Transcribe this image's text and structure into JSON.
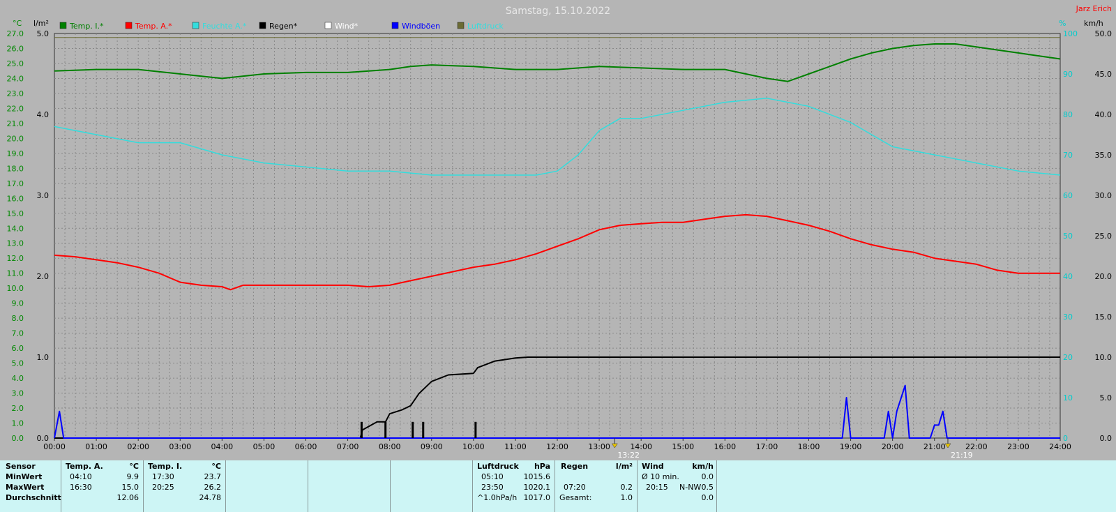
{
  "title": "Samstag, 15.10.2022",
  "author": "Jarz Erich",
  "colors": {
    "background": "#b5b5b5",
    "plot_bg": "#b5b5b5",
    "temp_inside": "#008000",
    "temp_outside": "#ff0000",
    "humidity": "#33dddd",
    "rain": "#000000",
    "wind": "#ffffff",
    "gusts": "#0000ff",
    "pressure": "#6b6b33",
    "temp_axis": "#008800",
    "right_axis": "#00cccc"
  },
  "chart_data": {
    "type": "line",
    "title": "Samstag, 15.10.2022",
    "x_ticks": [
      "00:00",
      "01:00",
      "02:00",
      "03:00",
      "04:00",
      "05:00",
      "06:00",
      "07:00",
      "08:00",
      "09:00",
      "10:00",
      "11:00",
      "12:00",
      "13:00",
      "14:00",
      "15:00",
      "16:00",
      "17:00",
      "18:00",
      "19:00",
      "20:00",
      "21:00",
      "22:00",
      "23:00",
      "24:00"
    ],
    "xlim": [
      0,
      24
    ],
    "axes": {
      "temp": {
        "unit": "°C",
        "ylim": [
          0,
          27
        ],
        "ticks": [
          "0.0",
          "1.0",
          "2.0",
          "3.0",
          "4.0",
          "5.0",
          "6.0",
          "7.0",
          "8.0",
          "9.0",
          "10.0",
          "11.0",
          "12.0",
          "13.0",
          "14.0",
          "15.0",
          "16.0",
          "17.0",
          "18.0",
          "19.0",
          "20.0",
          "21.0",
          "22.0",
          "23.0",
          "24.0",
          "25.0",
          "26.0",
          "27.0"
        ]
      },
      "rain": {
        "unit": "l/m²",
        "ylim": [
          0,
          5
        ],
        "ticks": [
          "0.0",
          "1.0",
          "2.0",
          "3.0",
          "4.0",
          "5.0"
        ]
      },
      "humidity": {
        "unit": "%",
        "ylim": [
          0,
          100
        ],
        "ticks": [
          "0",
          "10",
          "20",
          "30",
          "40",
          "50",
          "60",
          "70",
          "80",
          "90",
          "100"
        ]
      },
      "wind": {
        "unit": "km/h",
        "ylim": [
          0,
          50
        ],
        "ticks": [
          "0.0",
          "5.0",
          "10.0",
          "15.0",
          "20.0",
          "25.0",
          "30.0",
          "35.0",
          "40.0",
          "45.0",
          "50.0"
        ]
      }
    },
    "legend": [
      "Temp. I.*",
      "Temp. A.*",
      "Feuchte A.*",
      "Regen*",
      "Wind*",
      "Windböen",
      "Luftdruck"
    ],
    "series": [
      {
        "name": "Temp. I.*",
        "axis": "temp",
        "x": [
          0,
          1,
          2,
          3,
          4,
          5,
          6,
          7,
          8,
          8.5,
          9,
          10,
          11,
          12,
          13,
          14,
          15,
          16,
          16.5,
          17,
          17.5,
          18,
          18.5,
          19,
          19.5,
          20,
          20.5,
          21,
          21.5,
          22,
          22.5,
          23,
          23.5,
          24
        ],
        "y": [
          24.5,
          24.6,
          24.6,
          24.3,
          24.0,
          24.3,
          24.4,
          24.4,
          24.6,
          24.8,
          24.9,
          24.8,
          24.6,
          24.6,
          24.8,
          24.7,
          24.6,
          24.6,
          24.3,
          24.0,
          23.8,
          24.3,
          24.8,
          25.3,
          25.7,
          26.0,
          26.2,
          26.3,
          26.3,
          26.1,
          25.9,
          25.7,
          25.5,
          25.3
        ]
      },
      {
        "name": "Temp. A.*",
        "axis": "temp",
        "x": [
          0,
          0.5,
          1,
          1.5,
          2,
          2.5,
          3,
          3.5,
          4,
          4.2,
          4.5,
          5,
          6,
          7,
          7.5,
          8,
          8.5,
          9,
          9.5,
          10,
          10.5,
          11,
          11.5,
          12,
          12.5,
          13,
          13.5,
          14,
          14.5,
          15,
          15.5,
          16,
          16.5,
          17,
          17.5,
          18,
          18.5,
          19,
          19.5,
          20,
          20.5,
          21,
          21.5,
          22,
          22.5,
          23,
          23.5,
          24
        ],
        "y": [
          12.2,
          12.1,
          11.9,
          11.7,
          11.4,
          11.0,
          10.4,
          10.2,
          10.1,
          9.9,
          10.2,
          10.2,
          10.2,
          10.2,
          10.1,
          10.2,
          10.5,
          10.8,
          11.1,
          11.4,
          11.6,
          11.9,
          12.3,
          12.8,
          13.3,
          13.9,
          14.2,
          14.3,
          14.4,
          14.4,
          14.6,
          14.8,
          14.9,
          14.8,
          14.5,
          14.2,
          13.8,
          13.3,
          12.9,
          12.6,
          12.4,
          12.0,
          11.8,
          11.6,
          11.2,
          11.0,
          11.0,
          11.0
        ]
      },
      {
        "name": "Feuchte A.*",
        "axis": "humidity",
        "x": [
          0,
          1,
          2,
          3,
          4,
          5,
          6,
          7,
          8,
          9,
          10,
          11,
          11.5,
          12,
          12.5,
          13,
          13.5,
          14,
          15,
          16,
          17,
          17.5,
          18,
          19,
          20,
          21,
          22,
          23,
          24
        ],
        "y": [
          77,
          75,
          73,
          73,
          70,
          68,
          67,
          66,
          66,
          65,
          65,
          65,
          65,
          66,
          70,
          76,
          79,
          79,
          81,
          83,
          84,
          83,
          82,
          78,
          72,
          70,
          68,
          66,
          65
        ]
      },
      {
        "name": "Regen*",
        "axis": "rain",
        "x": [
          0,
          7.3,
          7.35,
          7.7,
          7.9,
          8.0,
          8.3,
          8.5,
          8.7,
          9.0,
          9.4,
          10.0,
          10.1,
          10.5,
          11.0,
          11.3,
          12.0,
          24.0
        ],
        "y": [
          0,
          0,
          0.1,
          0.2,
          0.2,
          0.3,
          0.35,
          0.4,
          0.55,
          0.7,
          0.78,
          0.8,
          0.87,
          0.95,
          0.99,
          1.0,
          1.0,
          1.0
        ]
      },
      {
        "name": "Windböen",
        "axis": "wind",
        "x": [
          0,
          0.12,
          0.22,
          0.35,
          18.8,
          18.9,
          19.0,
          19.8,
          19.9,
          20.0,
          20.1,
          20.3,
          20.4,
          20.9,
          21.0,
          21.1,
          21.2,
          21.3,
          24
        ],
        "y": [
          0,
          3.3,
          0,
          0,
          0,
          5.0,
          0,
          0,
          3.3,
          0,
          3.3,
          6.5,
          0,
          0,
          1.6,
          1.6,
          3.3,
          0,
          0
        ]
      },
      {
        "name": "Luftdruck",
        "axis": "humidity",
        "x": [
          0,
          24
        ],
        "y": [
          99,
          99
        ]
      }
    ],
    "rain_bars": {
      "name": "Regen",
      "x": [
        7.33,
        7.9,
        8.55,
        8.8,
        10.05
      ],
      "y": [
        0.2,
        0.2,
        0.2,
        0.2,
        0.2
      ]
    },
    "markers": [
      {
        "label": "13:22",
        "x": 13.37
      },
      {
        "label": "21:19",
        "x": 21.32
      }
    ]
  },
  "table": {
    "sensor": {
      "header": "Sensor",
      "rows": [
        "MinWert",
        "MaxWert",
        "Durchschnitt"
      ]
    },
    "temp_a": {
      "header": "Temp. A.",
      "unit": "°C",
      "min_time": "04:10",
      "min_val": "9.9",
      "max_time": "16:30",
      "max_val": "15.0",
      "avg": "12.06"
    },
    "temp_i": {
      "header": "Temp. I.",
      "unit": "°C",
      "min_time": "17:30",
      "min_val": "23.7",
      "max_time": "20:25",
      "max_val": "26.2",
      "avg": "24.78"
    },
    "pressure": {
      "header": "Luftdruck",
      "unit": "hPa",
      "r1_time": "05:10",
      "r1_val": "1015.6",
      "r2_time": "23:50",
      "r2_val": "1020.1",
      "r3_time": "^1.0hPa/h",
      "r3_val": "1017.0"
    },
    "rain": {
      "header": "Regen",
      "unit": "l/m²",
      "r2_time": "07:20",
      "r2_val": "0.2",
      "r3_label": "Gesamt:",
      "r3_val": "1.0"
    },
    "wind": {
      "header": "Wind",
      "unit": "km/h",
      "r1_label": "Ø 10 min.",
      "r1_val": "0.0",
      "r2_time": "20:15",
      "r2_dir": "N-NW",
      "r2_val": "0.5",
      "r3_val": "0.0"
    }
  }
}
